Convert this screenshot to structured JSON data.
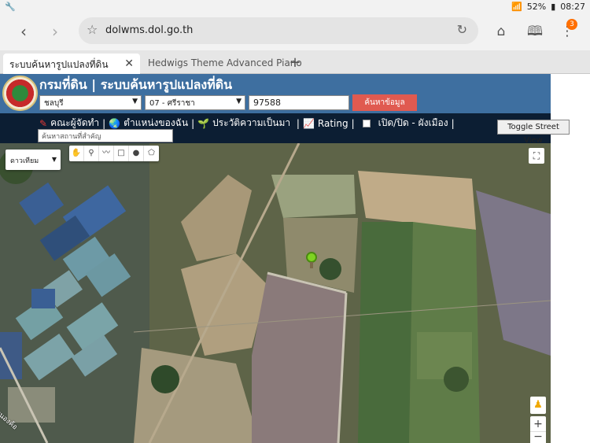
{
  "status": {
    "battery": "52%",
    "time": "08:27"
  },
  "browser": {
    "url": "dolwms.dol.go.th",
    "tab_badge": "3",
    "tabs": [
      {
        "label": "ระบบค้นหารูปแปลงที่ดิน"
      },
      {
        "label": "Hedwigs Theme Advanced Piano"
      }
    ]
  },
  "site": {
    "title": "กรมที่ดิน | ระบบค้นหารูปแปลงที่ดิน",
    "province": "ชลบุรี",
    "district": "07 - ศรีราชา",
    "parcel_number": "97588",
    "search_button": "ค้นหาข้อมูล"
  },
  "menu": {
    "team": "คณะผู้จัดทำ",
    "my_location": "ตำแหน่งของฉัน",
    "history": "ประวัติความเป็นมา",
    "rating": "Rating",
    "city_plan": "เปิด/ปิด - ผังเมือง",
    "place_search_placeholder": "ค้นหาสถานที่สำคัญ",
    "street_view": "Toggle Street View"
  },
  "map": {
    "map_type": "ดาวเทียม",
    "road_label": "หนองค้อ"
  }
}
